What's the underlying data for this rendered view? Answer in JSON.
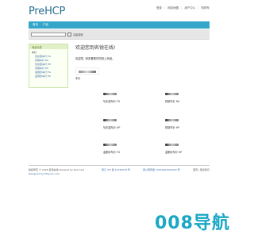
{
  "header": {
    "logo": "PreHCP",
    "top_links": [
      "登录",
      "网站地图",
      "用户中心",
      "购物车"
    ]
  },
  "nav": {
    "items": [
      "首页",
      "产品"
    ]
  },
  "search": {
    "placeholder": "",
    "button_label": "高级搜索"
  },
  "sidebar": {
    "title": "商品分类",
    "items": [
      {
        "label": "车针",
        "type": "parent"
      },
      {
        "label": "氧化锆车针 FG",
        "type": "child"
      },
      {
        "label": "钨钢车针 RA",
        "type": "child"
      },
      {
        "label": "氧化锆车针 HP",
        "type": "child"
      },
      {
        "label": "钨钢车针 HP",
        "type": "child"
      },
      {
        "label": "金刚砂车针 FG",
        "type": "child"
      },
      {
        "label": "金刚砂车针 HP",
        "type": "child"
      }
    ]
  },
  "main": {
    "title": "欢迎您到名锐在线!",
    "welcome_text": "欢迎您, 请多看看们的网上商品。",
    "banner_caption": "车针",
    "products": [
      {
        "label": "氧化锆车针 FG"
      },
      {
        "label": "钨钢车针 RA"
      },
      {
        "label": "氧化锆车针 HP"
      },
      {
        "label": "钨钢车针 HP"
      },
      {
        "label": "金刚砂车针 FG"
      },
      {
        "label": "金刚砂车针 HP"
      }
    ]
  },
  "footer": {
    "left_line1": "版权所有 © 2025 名锐在线 Powered by Zen Cart",
    "left_line2": "Designed by Zhiyuan.com",
    "mid_line1": "浙江 ICP 备 12345678 号",
    "mid_line2": "浙公网安备 33010602000000 号",
    "right_line1": "首页 | 联系我们"
  },
  "watermark": "008导航"
}
